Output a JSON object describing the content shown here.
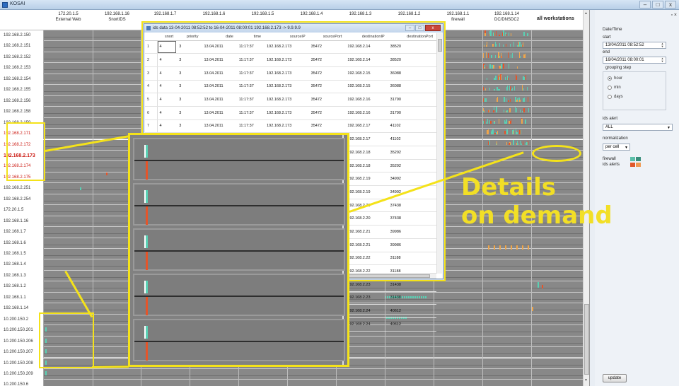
{
  "window": {
    "title": "KOSAI",
    "controls": [
      "–",
      "□",
      "x"
    ]
  },
  "columns": [
    {
      "ip": "172.20.1.5",
      "name": "External Web"
    },
    {
      "ip": "192.168.1.16",
      "name": "SnortIDS"
    },
    {
      "ip": "192.168.1.7",
      "name": ""
    },
    {
      "ip": "192.168.1.6",
      "name": ""
    },
    {
      "ip": "192.168.1.5",
      "name": ""
    },
    {
      "ip": "192.168.1.4",
      "name": ""
    },
    {
      "ip": "192.168.1.3",
      "name": ""
    },
    {
      "ip": "192.168.1.2",
      "name": ""
    },
    {
      "ip": "192.168.1.1",
      "name": "firewall"
    },
    {
      "ip": "192.168.1.14",
      "name": "DC/DNSDC2"
    },
    {
      "ip": "",
      "name": "all workstations"
    }
  ],
  "rows": [
    "192.168.2.150",
    "192.168.2.151",
    "192.168.2.152",
    "192.168.2.153",
    "192.168.2.154",
    "192.168.2.155",
    "192.168.2.156",
    "192.168.2.158",
    "192.168.2.159",
    "192.168.2.171",
    "192.168.2.172",
    "192.168.2.173",
    "192.168.2.174",
    "192.168.2.175",
    "192.168.2.251",
    "192.168.2.254",
    "172.20.1.5",
    "192.168.1.16",
    "192.168.1.7",
    "192.168.1.6",
    "192.168.1.5",
    "192.168.1.4",
    "192.168.1.3",
    "192.168.1.2",
    "192.168.1.1",
    "192.168.1.14",
    "10.200.150.2",
    "10.200.150.201",
    "10.200.150.206",
    "10.200.150.207",
    "10.200.150.208",
    "10.200.150.209",
    "10.200.150.6"
  ],
  "alert_rows": [
    9,
    10,
    11,
    12,
    13
  ],
  "bold_row": 11,
  "dialog": {
    "title": "ids data 13-04-2011 08:52:52 to 16-04-2011 08:00:01 192.168.2.173 -> 9.9.9.9",
    "headers": [
      "snort",
      "priority",
      "date",
      "time",
      "sourceIP",
      "sourcePort",
      "destinationIP",
      "destinationPort"
    ],
    "rows": [
      [
        "1",
        "4",
        "3",
        "13.04.2011",
        "11:17:37",
        "192.168.2.173",
        "35472",
        "192.168.2.14",
        "38520"
      ],
      [
        "2",
        "4",
        "3",
        "13.04.2011",
        "11:17:37",
        "192.168.2.173",
        "35472",
        "192.168.2.14",
        "38520"
      ],
      [
        "3",
        "4",
        "3",
        "13.04.2011",
        "11:17:37",
        "192.168.2.173",
        "35472",
        "192.168.2.15",
        "36088"
      ],
      [
        "4",
        "4",
        "3",
        "13.04.2011",
        "11:17:37",
        "192.168.2.173",
        "35472",
        "192.168.2.15",
        "36088"
      ],
      [
        "5",
        "4",
        "3",
        "13.04.2011",
        "11:17:37",
        "192.168.2.173",
        "35472",
        "192.168.2.16",
        "31790"
      ],
      [
        "6",
        "4",
        "3",
        "13.04.2011",
        "11:17:37",
        "192.168.2.173",
        "35472",
        "192.168.2.16",
        "31790"
      ],
      [
        "7",
        "4",
        "3",
        "13.04.2011",
        "11:17:37",
        "192.168.2.173",
        "35472",
        "192.168.2.17",
        "41102"
      ],
      [
        "8",
        "4",
        "3",
        "13.04.2011",
        "11:17:37",
        "192.168.2.173",
        "35472",
        "192.168.2.17",
        "41102"
      ],
      [
        "",
        "",
        "",
        "",
        "",
        "",
        "",
        "192.168.2.18",
        "35292"
      ],
      [
        "",
        "",
        "",
        "",
        "",
        "",
        "",
        "192.168.2.18",
        "35292"
      ],
      [
        "",
        "",
        "",
        "",
        "",
        "",
        "",
        "192.168.2.19",
        "34992"
      ],
      [
        "",
        "",
        "",
        "",
        "",
        "",
        "",
        "192.168.2.19",
        "34992"
      ],
      [
        "",
        "",
        "",
        "",
        "",
        "",
        "",
        "192.168.2.20",
        "37438"
      ],
      [
        "",
        "",
        "",
        "",
        "",
        "",
        "",
        "192.168.2.20",
        "37438"
      ],
      [
        "",
        "",
        "",
        "",
        "",
        "",
        "",
        "192.168.2.21",
        "39986"
      ],
      [
        "",
        "",
        "",
        "",
        "",
        "",
        "",
        "192.168.2.21",
        "39986"
      ],
      [
        "",
        "",
        "",
        "",
        "",
        "",
        "",
        "192.168.2.22",
        "31188"
      ],
      [
        "",
        "",
        "",
        "",
        "",
        "",
        "",
        "192.168.2.22",
        "31188"
      ]
    ],
    "rows_right": [
      [
        "192.168.2.23",
        "31438"
      ],
      [
        "192.168.2.23",
        "31438"
      ],
      [
        "192.168.2.24",
        "40612"
      ],
      [
        "192.168.2.24",
        "40612"
      ]
    ]
  },
  "sidebar": {
    "section_title": "Date/Time",
    "start_label": "start",
    "start_value": "13/04/2011 08:52:52",
    "end_label": "end",
    "end_value": "16/04/2011 08:00:01",
    "grouping_label": "grouping step",
    "grouping_options": [
      "hour",
      "min",
      "days"
    ],
    "grouping_selected": "hour",
    "ids_alert_label": "ids alert",
    "ids_alert_value": "ALL",
    "normalization_label": "normalization",
    "normalization_value": "per cell",
    "legend": [
      {
        "label": "firewall",
        "colors": [
          "#5bbfa9",
          "#3a8f7c"
        ]
      },
      {
        "label": "ids alerts",
        "colors": [
          "#e0582a",
          "#f09a52"
        ]
      }
    ],
    "update_label": "update"
  },
  "annotation": {
    "callout_line1": "Details",
    "callout_line2": "on demand"
  },
  "colors": {
    "annotation": "#f4e21a",
    "firewall": "#5ad0b4",
    "ids": "#e4552a",
    "alert_text": "#cc1a12"
  }
}
